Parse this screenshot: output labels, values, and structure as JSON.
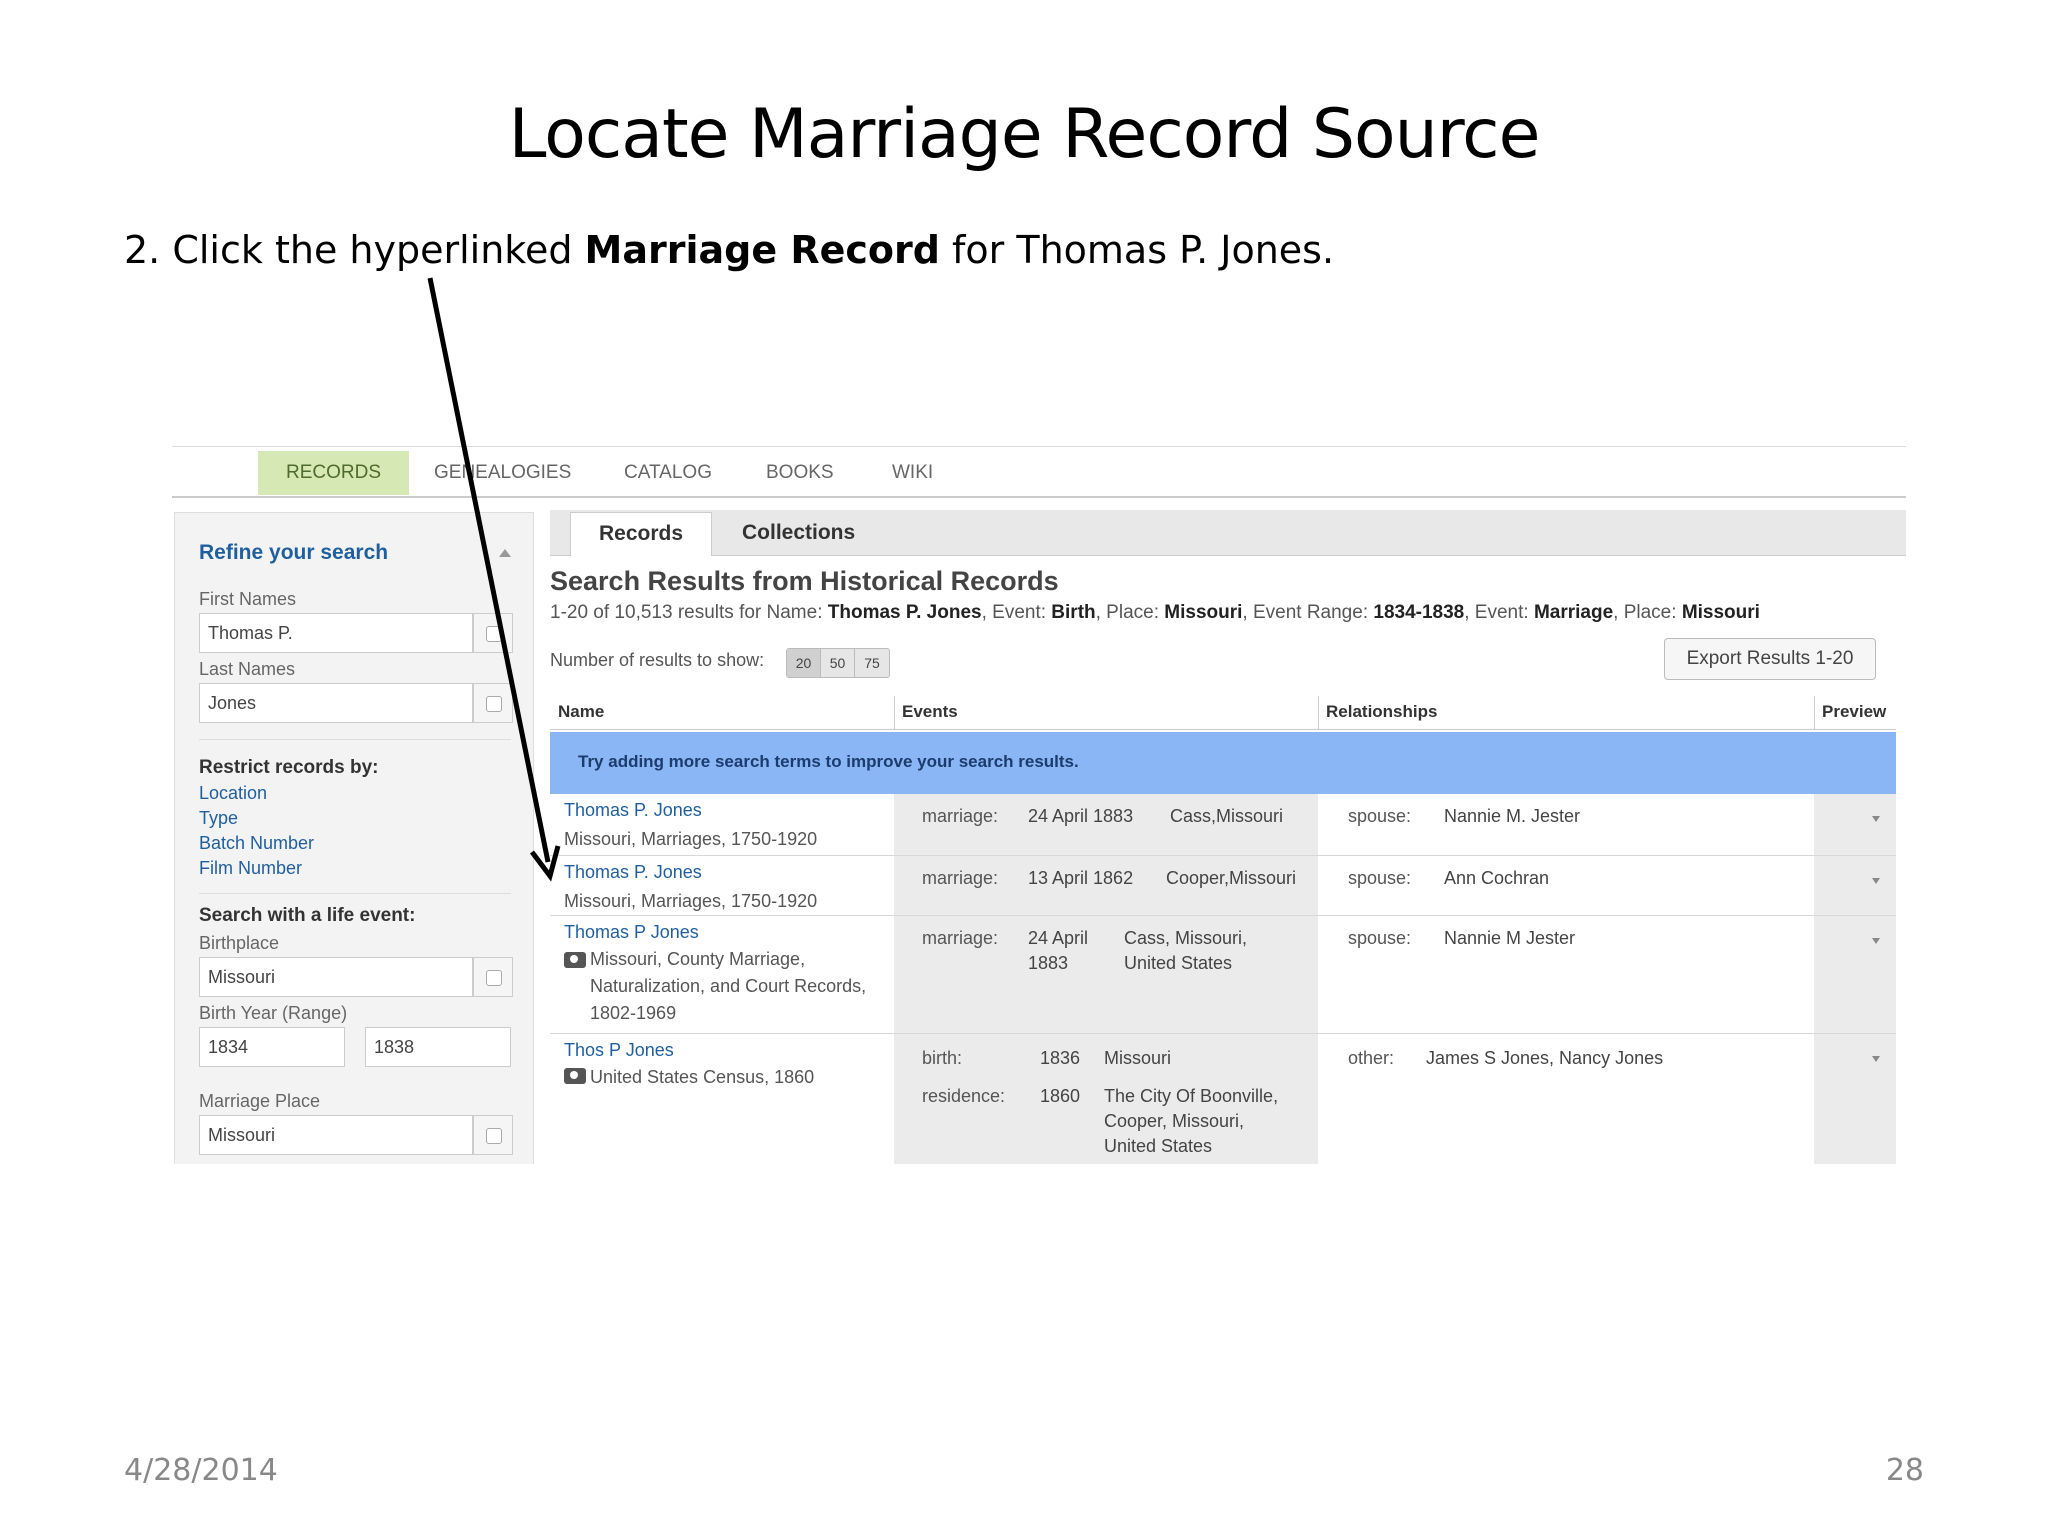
{
  "slide": {
    "title": "Locate Marriage Record Source",
    "instruction_pre": "2. Click the hyperlinked ",
    "instruction_bold": "Marriage Record",
    "instruction_post": " for Thomas P. Jones.",
    "date": "4/28/2014",
    "page_number": "28"
  },
  "topnav": {
    "items": [
      "RECORDS",
      "GENEALOGIES",
      "CATALOG",
      "BOOKS",
      "WIKI"
    ],
    "active": "RECORDS"
  },
  "sidebar": {
    "title": "Refine your search",
    "first_names_label": "First Names",
    "first_names_value": "Thomas P.",
    "last_names_label": "Last Names",
    "last_names_value": "Jones",
    "restrict_heading": "Restrict records by:",
    "restrict_links": [
      "Location",
      "Type",
      "Batch Number",
      "Film Number"
    ],
    "life_event_heading": "Search with a life event:",
    "birthplace_label": "Birthplace",
    "birthplace_value": "Missouri",
    "birth_year_label": "Birth Year (Range)",
    "birth_year_from": "1834",
    "birth_year_to": "1838",
    "marriage_place_label": "Marriage Place",
    "marriage_place_value": "Missouri"
  },
  "main": {
    "tabs": [
      "Records",
      "Collections"
    ],
    "results_title": "Search Results from Historical Records",
    "summary": {
      "prefix": "1-20 of 10,513 results for Name: ",
      "name": "Thomas P. Jones",
      "event1_label": ", Event: ",
      "event1": "Birth",
      "place1_label": ", Place: ",
      "place1": "Missouri",
      "range_label": ", Event Range: ",
      "range": "1834-1838",
      "event2_label": ", Event: ",
      "event2": "Marriage",
      "place2_label": ", Place: ",
      "place2": "Missouri"
    },
    "num_results_label": "Number of results to show:",
    "num_results_options": [
      "20",
      "50",
      "75"
    ],
    "export_label": "Export Results 1-20",
    "columns": [
      "Name",
      "Events",
      "Relationships",
      "Preview"
    ],
    "notice": "Try adding more search terms to improve your search results.",
    "rows": [
      {
        "name": "Thomas P. Jones",
        "collection": "Missouri, Marriages, 1750-1920",
        "event_type": "marriage:",
        "event_date": "24 April 1883",
        "event_place": "Cass,Missouri",
        "rel_type": "spouse:",
        "rel_value": "Nannie M. Jester"
      },
      {
        "name": "Thomas P. Jones",
        "collection": "Missouri, Marriages, 1750-1920",
        "event_type": "marriage:",
        "event_date": "13 April 1862",
        "event_place": "Cooper,Missouri",
        "rel_type": "spouse:",
        "rel_value": "Ann Cochran"
      },
      {
        "name": "Thomas P Jones",
        "collection_lines": [
          "Missouri, County Marriage,",
          "Naturalization, and Court Records,",
          "1802-1969"
        ],
        "event_type": "marriage:",
        "event_date_lines": [
          "24 April",
          "1883"
        ],
        "event_place_lines": [
          "Cass, Missouri,",
          "United States"
        ],
        "rel_type": "spouse:",
        "rel_value": "Nannie M Jester"
      },
      {
        "name": "Thos P Jones",
        "collection": "United States Census, 1860",
        "event1_type": "birth:",
        "event1_date": "1836",
        "event1_place": "Missouri",
        "event2_type": "residence:",
        "event2_date": "1860",
        "event2_place_lines": [
          "The City Of Boonville,",
          "Cooper, Missouri,",
          "United States"
        ],
        "rel_type": "other:",
        "rel_value": "James S Jones, Nancy Jones"
      }
    ]
  },
  "colors": {
    "active_tab_bg": "#d6e8b4",
    "link_blue": "#1f5f9e",
    "notice_bg": "#8ab6f5"
  }
}
